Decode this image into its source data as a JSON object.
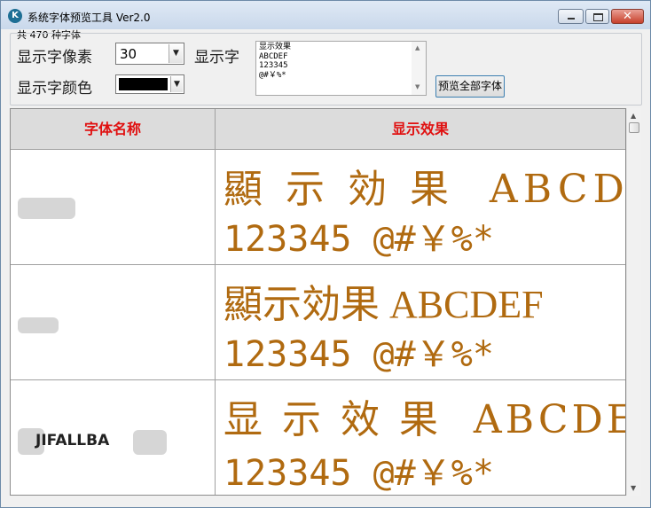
{
  "window": {
    "title": "系统字体预览工具 Ver2.0",
    "app_icon_glyph": "K"
  },
  "summary": {
    "count_text": "共 470 种字体"
  },
  "controls": {
    "pixel_label": "显示字像素",
    "pixel_value": "30",
    "text_label": "显示字",
    "color_label": "显示字颜色",
    "color_value": "#000000",
    "sample_text": "显示效果\nABCDEF\n123345\n@#￥%*",
    "preview_all_label": "预览全部字体"
  },
  "table": {
    "headers": {
      "font_name": "字体名称",
      "display_effect": "显示效果"
    },
    "sample_line1": "顯示効果 ABCDEF",
    "sample_line2": "123345 @#￥%*",
    "rows": [
      {
        "font_name": "",
        "line1": "顯 示 効 果  ABCDEF",
        "line2": "123345 @#￥%*"
      },
      {
        "font_name": "",
        "line1": "顯示効果 ABCDEF",
        "line2": "123345 @#￥%*"
      },
      {
        "font_name": "JIFALLBA",
        "line1": "显 示 效 果  ABCDEF",
        "line2": "123345 @#￥%*"
      }
    ]
  },
  "colors": {
    "header_text": "#e01010",
    "sample_text": "#b06a10",
    "title_bar": "#c9d8eb"
  }
}
